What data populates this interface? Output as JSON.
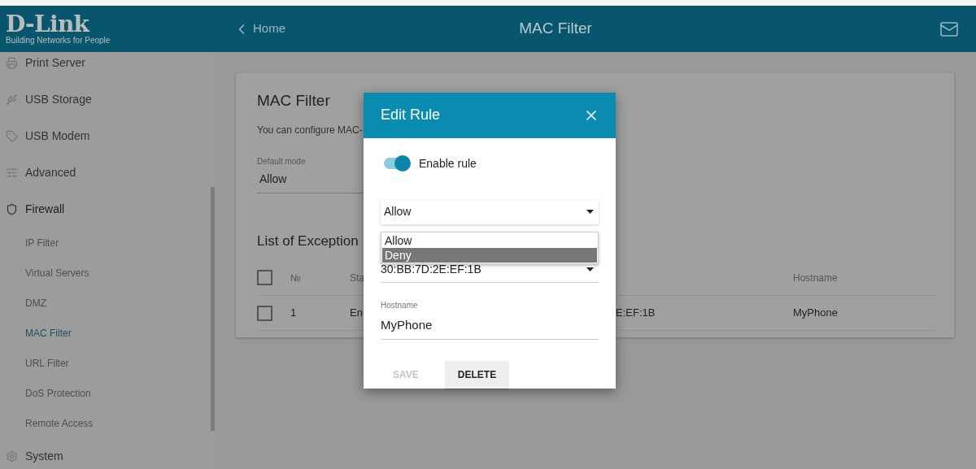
{
  "header": {
    "logo_title": "D-Link",
    "logo_tagline": "Building Networks for People",
    "back": "Home",
    "title": "MAC Filter"
  },
  "sidebar": {
    "items": [
      {
        "label": "Print Server",
        "expanded": false
      },
      {
        "label": "USB Storage",
        "expanded": false
      },
      {
        "label": "USB Modem",
        "expanded": false
      },
      {
        "label": "Advanced",
        "expanded": false
      },
      {
        "label": "Firewall",
        "expanded": true,
        "children": [
          {
            "label": "IP Filter",
            "selected": false
          },
          {
            "label": "Virtual Servers",
            "selected": false
          },
          {
            "label": "DMZ",
            "selected": false
          },
          {
            "label": "MAC Filter",
            "selected": true
          },
          {
            "label": "URL Filter",
            "selected": false
          },
          {
            "label": "DoS Protection",
            "selected": false
          },
          {
            "label": "Remote Access",
            "selected": false
          }
        ]
      },
      {
        "label": "System",
        "expanded": false
      }
    ]
  },
  "card": {
    "title": "MAC Filter",
    "description": "You can configure MAC-",
    "default_mode": {
      "label": "Default mode",
      "value": "Allow"
    },
    "exceptions_title": "List of Exception",
    "table": {
      "header": {
        "checked": false,
        "no": "№",
        "status": "Sta",
        "hostname": "Hostname"
      },
      "rows": [
        {
          "checked": false,
          "no": "1",
          "status": "En",
          "mac": "E:EF:1B",
          "hostname": "MyPhone"
        }
      ]
    }
  },
  "dialog": {
    "title": "Edit Rule",
    "enable_rule": {
      "label": "Enable rule",
      "on": true
    },
    "action_select": {
      "value": "Allow"
    },
    "dropdown": {
      "options": [
        {
          "label": "Allow",
          "selected": false
        },
        {
          "label": "Deny",
          "selected": true
        }
      ]
    },
    "mac_select": {
      "value": "30:BB:7D:2E:EF:1B"
    },
    "hostname": {
      "label": "Hostname",
      "value": "MyPhone"
    },
    "buttons": [
      {
        "label": "SAVE",
        "disabled": true
      },
      {
        "label": "DELETE",
        "disabled": false
      }
    ]
  }
}
